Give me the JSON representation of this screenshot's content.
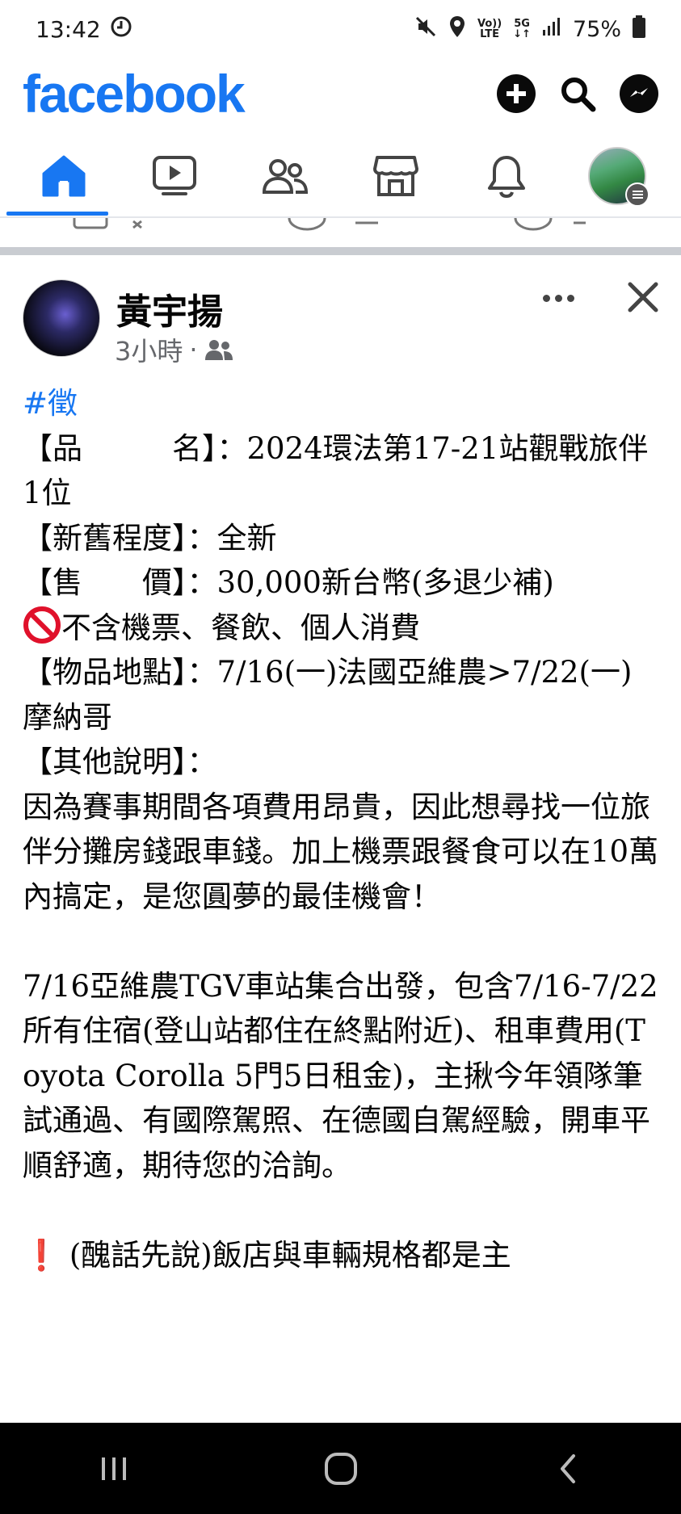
{
  "status_bar": {
    "time": "13:42",
    "battery": "75%",
    "network_top": "Vo))",
    "network_bottom": "LTE",
    "signal_label": "5G"
  },
  "header": {
    "logo": "facebook"
  },
  "nav": {
    "active_tab": "home",
    "tabs": [
      "home",
      "watch",
      "friends",
      "marketplace",
      "notifications",
      "profile"
    ]
  },
  "post": {
    "author": "黃宇揚",
    "time": "3小時",
    "audience_separator": "·",
    "hashtag": "#徵",
    "lines": {
      "item": "【品　　　名】：2024環法第17-21站觀戰旅伴1位",
      "condition": "【新舊程度】：全新",
      "price": "【售　　價】：30,000新台幣(多退少補)",
      "exclusions": "不含機票、餐飲、個人消費",
      "location": "【物品地點】：7/16(一)法國亞維農>7/22(一)摩納哥",
      "other_label": "【其他說明】：",
      "desc1": "因為賽事期間各項費用昂貴，因此想尋找一位旅伴分攤房錢跟車錢。加上機票跟餐食可以在10萬內搞定，是您圓夢的最佳機會！",
      "desc2": "7/16亞維農TGV車站集合出發，包含7/16-7/22所有住宿(登山站都住在終點附近)、租車費用(Toyota Corolla 5門5日租金)，主揪今年領隊筆試通過、有國際駕照、在德國自駕經驗，開車平順舒適，期待您的洽詢。",
      "warning": "(醜話先說)飯店與車輛規格都是主"
    }
  },
  "colors": {
    "brand": "#1877f2",
    "text": "#050505",
    "meta": "#65676b",
    "warning": "#e0112b"
  }
}
